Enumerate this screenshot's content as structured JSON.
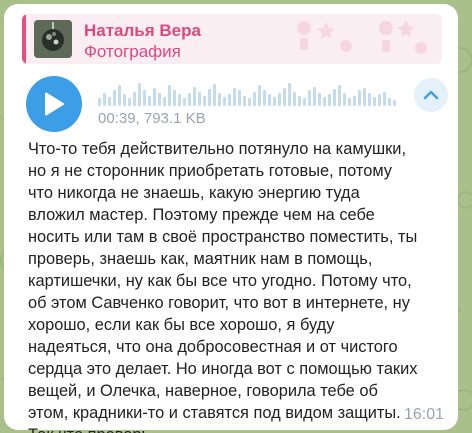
{
  "reply": {
    "sender": "Наталья Вера",
    "subtitle": "Фотография"
  },
  "audio": {
    "duration": "00:39",
    "size": "793.1 KB",
    "meta": "00:39, 793.1 KB",
    "wave_heights": [
      0.3,
      0.5,
      0.35,
      0.6,
      0.8,
      0.45,
      0.3,
      0.55,
      0.9,
      0.6,
      0.4,
      0.7,
      0.5,
      0.35,
      0.8,
      0.6,
      0.45,
      0.3,
      0.5,
      0.75,
      0.55,
      0.4,
      0.65,
      0.85,
      0.5,
      0.35,
      0.45,
      0.7,
      0.6,
      0.4,
      0.3,
      0.55,
      0.8,
      0.6,
      0.45,
      0.35,
      0.5,
      0.7,
      0.9,
      0.55,
      0.4,
      0.3,
      0.6,
      0.75,
      0.5,
      0.35,
      0.45,
      0.65,
      0.8,
      0.5,
      0.3,
      0.4,
      0.6,
      0.7,
      0.5,
      0.35,
      0.45,
      0.55,
      0.3,
      0.25
    ]
  },
  "message": {
    "transcript": "Что-то тебя действительно потянуло на камушки, но я не сторонник приобретать готовые, потому что никогда не знаешь, какую энергию туда вложил мастер. Поэтому прежде чем на себе носить или там в своё пространство поместить, ты проверь, знаешь как, маятник нам в помощь, картишечки, ну как бы все что угодно. Потому что, об этом Савченко говорит, что вот в интернете, ну хорошо, если как бы все хорошо, я буду надеяться, что она добросовестная и от чистого сердца это делает. Но иногда вот с помощью таких вещей, и Олечка, наверное, говорила тебе об этом, крадники-то и ставятся под видом защиты. Так что проверь.",
    "time": "16:01"
  },
  "colors": {
    "accent": "#3d9ee8",
    "reply_accent": "#e0477e",
    "background": "#a9c08a"
  }
}
